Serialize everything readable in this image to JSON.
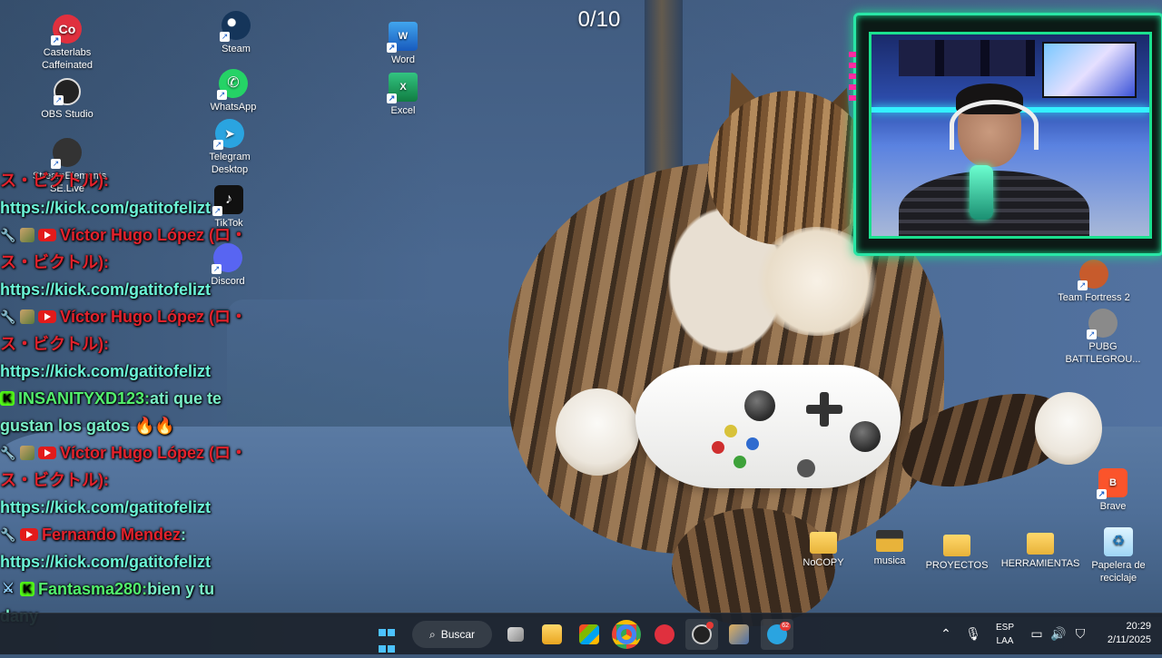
{
  "counter": "0/10",
  "desktop_icons": {
    "caffeinated": "Casterlabs Caffeinated",
    "obs": "OBS Studio",
    "streamelements": "StreamElements SE.Live",
    "steam": "Steam",
    "whatsapp": "WhatsApp",
    "telegram": "Telegram Desktop",
    "tiktok": "TikTok",
    "discord": "Discord",
    "word": "Word",
    "excel": "Excel",
    "tf2": "Team Fortress 2",
    "pubg": "PUBG BATTLEGROU...",
    "brave": "Brave",
    "nocopy": "NoCOPY",
    "musica": "musica",
    "proyectos": "PROYECTOS",
    "herramientas": "HERRAMIENTAS",
    "recycle": "Papelera de reciclaje"
  },
  "chat": [
    {
      "kind": "yt-cont",
      "text": "ス・ビクトル):"
    },
    {
      "kind": "link",
      "text": "https://kick.com/gatitofelizt"
    },
    {
      "kind": "yt-name",
      "name": "Víctor Hugo López (ロ・"
    },
    {
      "kind": "yt-cont",
      "text": "ス・ビクトル):"
    },
    {
      "kind": "link",
      "text": "https://kick.com/gatitofelizt"
    },
    {
      "kind": "yt-name",
      "name": "Víctor Hugo López (ロ・"
    },
    {
      "kind": "yt-cont",
      "text": "ス・ビクトル):"
    },
    {
      "kind": "link",
      "text": "https://kick.com/gatitofelizt"
    },
    {
      "kind": "kick-name",
      "name": "INSANITYXD123:",
      "text": " ati que te"
    },
    {
      "kind": "text",
      "text": "gustan los gatos 🔥🔥"
    },
    {
      "kind": "yt-name",
      "name": "Víctor Hugo López (ロ・"
    },
    {
      "kind": "yt-cont",
      "text": "ス・ビクトル):"
    },
    {
      "kind": "link",
      "text": "https://kick.com/gatitofelizt"
    },
    {
      "kind": "yt-name2",
      "name": "Fernando Mendez",
      "text": ":"
    },
    {
      "kind": "link",
      "text": "https://kick.com/gatitofelizt"
    },
    {
      "kind": "kick-name2",
      "name": "Fantasma280:",
      "text": " bien y tu"
    },
    {
      "kind": "text",
      "text": "dany"
    }
  ],
  "taskbar": {
    "search_label": "Buscar",
    "telegram_badge": "62",
    "lang_top": "ESP",
    "lang_bottom": "LAA",
    "time": "20:29",
    "date": "2/11/2025"
  },
  "colors": {
    "chat_red": "#e3222c",
    "chat_green": "#52f06d",
    "chat_link": "#6cf5d8",
    "cam_border": "#29e6a6",
    "taskbar_bg": "#1c222c"
  }
}
